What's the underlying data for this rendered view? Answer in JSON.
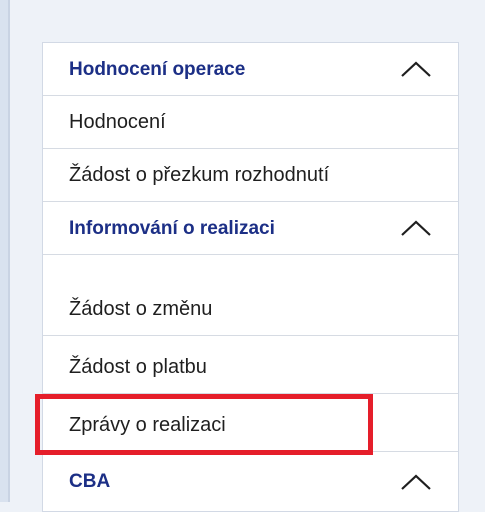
{
  "menu": {
    "sections": [
      {
        "title": "Hodnocení operace",
        "items": [
          "Hodnocení",
          "Žádost o přezkum rozhodnutí"
        ]
      },
      {
        "title": "Informování o realizaci",
        "items": [
          "Žádost o změnu",
          "Žádost o platbu",
          "Zprávy o realizaci"
        ]
      },
      {
        "title": "CBA",
        "items": []
      }
    ],
    "icons": {
      "collapse": "chevron-up-icon"
    }
  },
  "colors": {
    "header_text": "#1c2f86",
    "item_text": "#1f1f1f",
    "highlight_border": "#e51e2a"
  }
}
